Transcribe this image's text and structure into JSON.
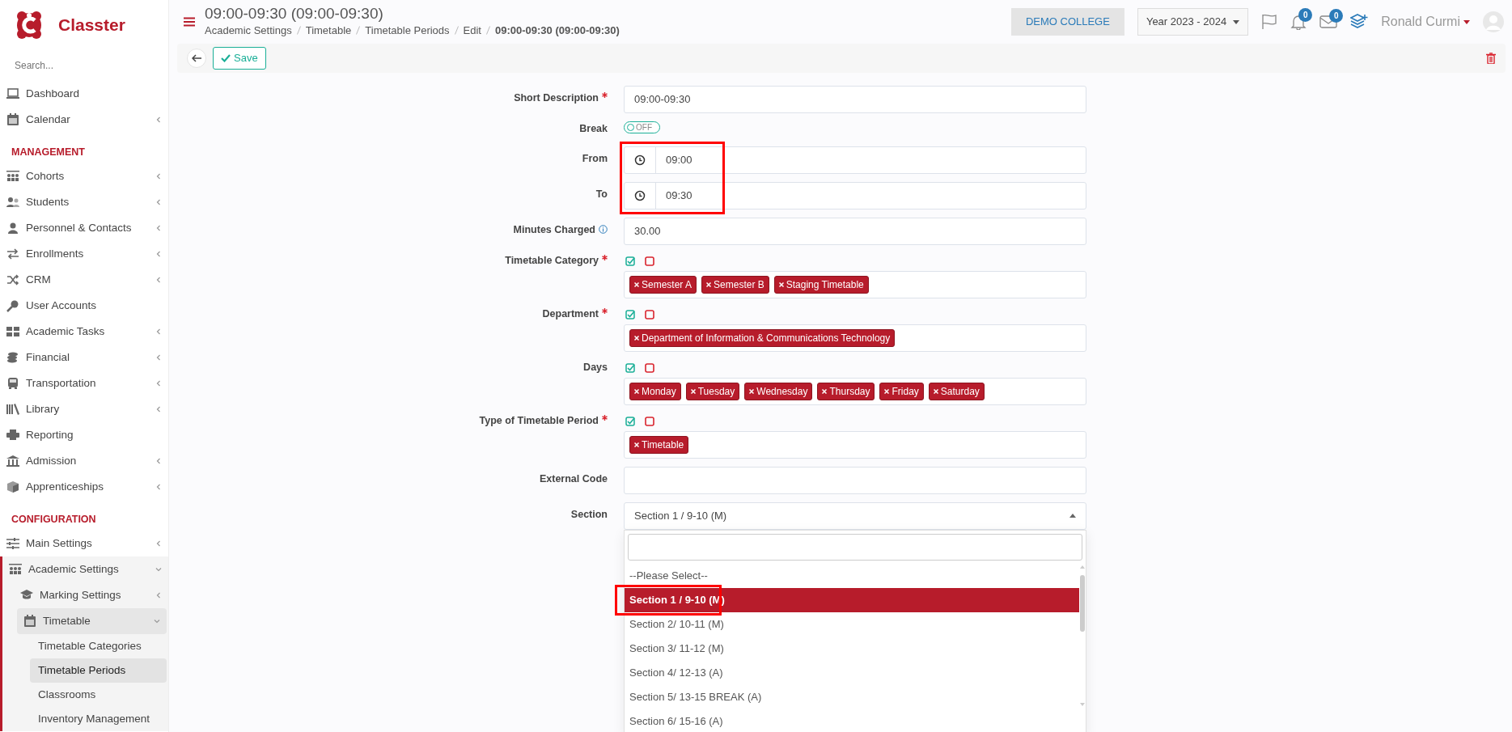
{
  "brand": {
    "name": "Classter"
  },
  "sidebar": {
    "search_placeholder": "Search...",
    "items": [
      {
        "kind": "item",
        "label": "Dashboard",
        "caret": false
      },
      {
        "kind": "item",
        "label": "Calendar",
        "caret": true,
        "expanded": false
      },
      {
        "kind": "header",
        "label": "MANAGEMENT"
      },
      {
        "kind": "item",
        "label": "Cohorts",
        "caret": true,
        "expanded": false
      },
      {
        "kind": "item",
        "label": "Students",
        "caret": true,
        "expanded": false
      },
      {
        "kind": "item",
        "label": "Personnel & Contacts",
        "caret": true,
        "expanded": false
      },
      {
        "kind": "item",
        "label": "Enrollments",
        "caret": true,
        "expanded": false
      },
      {
        "kind": "item",
        "label": "CRM",
        "caret": true,
        "expanded": false
      },
      {
        "kind": "item",
        "label": "User Accounts",
        "caret": false
      },
      {
        "kind": "item",
        "label": "Academic Tasks",
        "caret": true,
        "expanded": false
      },
      {
        "kind": "item",
        "label": "Financial",
        "caret": true,
        "expanded": false
      },
      {
        "kind": "item",
        "label": "Transportation",
        "caret": true,
        "expanded": false
      },
      {
        "kind": "item",
        "label": "Library",
        "caret": true,
        "expanded": false
      },
      {
        "kind": "item",
        "label": "Reporting",
        "caret": false
      },
      {
        "kind": "item",
        "label": "Admission",
        "caret": true,
        "expanded": false
      },
      {
        "kind": "item",
        "label": "Apprenticeships",
        "caret": true,
        "expanded": false
      },
      {
        "kind": "header",
        "label": "CONFIGURATION"
      },
      {
        "kind": "item",
        "label": "Main Settings",
        "caret": true,
        "expanded": false
      },
      {
        "kind": "item",
        "label": "Academic Settings",
        "caret": true,
        "expanded": true,
        "children": [
          {
            "kind": "item",
            "label": "Marking Settings",
            "caret": true,
            "expanded": false
          },
          {
            "kind": "item",
            "label": "Timetable",
            "caret": true,
            "expanded": true,
            "children": [
              {
                "label": "Timetable Categories",
                "selected": false
              },
              {
                "label": "Timetable Periods",
                "selected": true
              },
              {
                "label": "Classrooms",
                "selected": false
              },
              {
                "label": "Inventory Management",
                "selected": false
              }
            ]
          }
        ]
      }
    ]
  },
  "header": {
    "title": "09:00-09:30 (09:00-09:30)",
    "breadcrumbs": [
      "Academic Settings",
      "Timetable",
      "Timetable Periods",
      "Edit",
      "09:00-09:30 (09:00-09:30)"
    ],
    "college": "DEMO COLLEGE",
    "year": "Year 2023 - 2024",
    "notifications": "0",
    "messages": "0",
    "user": "Ronald Curmi"
  },
  "toolbar": {
    "save": "Save"
  },
  "form": [
    {
      "kind": "text",
      "label": "Short Description",
      "required": true,
      "value": "09:00-09:30"
    },
    {
      "kind": "toggle",
      "label": "Break",
      "on": false,
      "state_text": "OFF"
    },
    {
      "kind": "time",
      "label": "From",
      "value": "09:00",
      "highlighted": true
    },
    {
      "kind": "time",
      "label": "To",
      "value": "09:30",
      "highlighted": true
    },
    {
      "kind": "text",
      "label": "Minutes Charged",
      "info": true,
      "value": "30.00"
    },
    {
      "kind": "tags",
      "label": "Timetable Category",
      "required": true,
      "tags": [
        "Semester A",
        "Semester B",
        "Staging Timetable"
      ]
    },
    {
      "kind": "tags",
      "label": "Department",
      "required": true,
      "tags": [
        "Department of Information & Communications Technology"
      ]
    },
    {
      "kind": "tags",
      "label": "Days",
      "tags": [
        "Monday",
        "Tuesday",
        "Wednesday",
        "Thursday",
        "Friday",
        "Saturday"
      ]
    },
    {
      "kind": "tags",
      "label": "Type of Timetable Period",
      "required": true,
      "tags": [
        "Timetable"
      ]
    },
    {
      "kind": "text",
      "label": "External Code"
    },
    {
      "kind": "select",
      "label": "Section",
      "value": "Section 1 / 9-10 (M)",
      "open": true,
      "options": [
        {
          "label": "--Please Select--",
          "selected": false
        },
        {
          "label": "Section 1 / 9-10 (M)",
          "selected": true,
          "highlighted": true
        },
        {
          "label": "Section 2/ 10-11 (M)",
          "selected": false
        },
        {
          "label": "Section 3/ 11-12 (M)",
          "selected": false
        },
        {
          "label": "Section 4/ 12-13 (A)",
          "selected": false
        },
        {
          "label": "Section 5/ 13-15 BREAK (A)",
          "selected": false
        },
        {
          "label": "Section 6/ 15-16 (A)",
          "selected": false
        }
      ]
    }
  ]
}
